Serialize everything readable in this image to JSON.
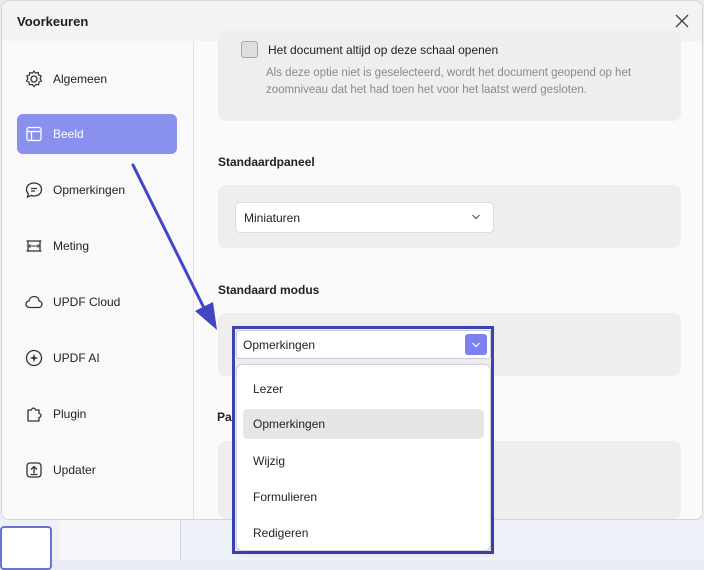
{
  "dialog": {
    "title": "Voorkeuren"
  },
  "sidebar": {
    "items": [
      {
        "label": "Algemeen",
        "icon": "gear-icon",
        "active": false
      },
      {
        "label": "Beeld",
        "icon": "layout-icon",
        "active": true
      },
      {
        "label": "Opmerkingen",
        "icon": "comment-icon",
        "active": false
      },
      {
        "label": "Meting",
        "icon": "ruler-icon",
        "active": false
      },
      {
        "label": "UPDF Cloud",
        "icon": "cloud-icon",
        "active": false
      },
      {
        "label": "UPDF AI",
        "icon": "ai-sparkle-icon",
        "active": false
      },
      {
        "label": "Plugin",
        "icon": "puzzle-icon",
        "active": false
      },
      {
        "label": "Updater",
        "icon": "update-icon",
        "active": false
      }
    ]
  },
  "zoom_option": {
    "checkbox_label": "Het document altijd op deze schaal openen",
    "checked": false,
    "description": "Als deze optie niet is geselecteerd, wordt het document geopend op het zoomniveau dat het had toen het voor het laatst werd gesloten."
  },
  "default_panel": {
    "title": "Standaardpaneel",
    "value": "Miniaturen"
  },
  "default_mode": {
    "title": "Standaard modus",
    "value": "Opmerkingen",
    "options": [
      "Lezer",
      "Opmerkingen",
      "Wijzig",
      "Formulieren",
      "Redigeren"
    ],
    "hovered_index": 1
  },
  "next_section": {
    "title_partial": "Pa"
  },
  "colors": {
    "accent": "#8a90ee",
    "highlight": "#3d42b5"
  }
}
